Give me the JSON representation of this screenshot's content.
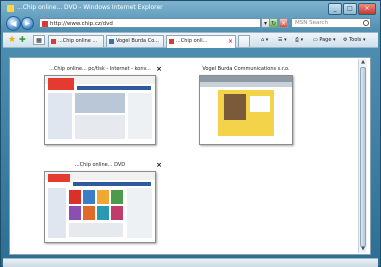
{
  "window": {
    "title": "...Chip online... DVD - Windows Internet Explorer",
    "buttons": [
      "_",
      "□",
      "×"
    ]
  },
  "nav": {
    "back_glyph": "◀",
    "forward_glyph": "▶",
    "address": "http://www.chip.cz/dvd",
    "search_placeholder": "MSN Search"
  },
  "tabs": [
    {
      "label": "...Chip online ..."
    },
    {
      "label": "Vogel Burda Co..."
    },
    {
      "label": "...Chip onli..."
    }
  ],
  "commands": {
    "page": "Page",
    "tools": "Tools"
  },
  "thumbnails": [
    {
      "title": "...Chip online... pc/tisk - Internet - konv...",
      "close": "×"
    },
    {
      "title": "Vogel Burda Communications s.r.o.",
      "close": "×"
    },
    {
      "title": "...Chip online... DVD",
      "close": "×"
    }
  ],
  "colors": {
    "frame": "#4f8fb2",
    "accent_blue": "#2f5a9b",
    "favicon_red": "#d63b3b",
    "star_gold": "#e8b100"
  }
}
